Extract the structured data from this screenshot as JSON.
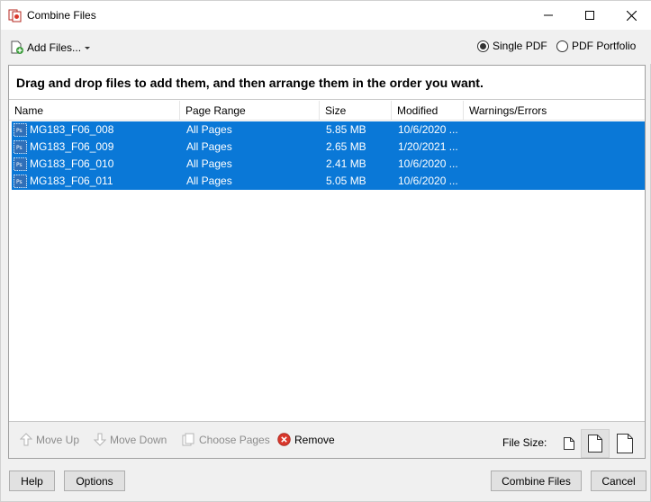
{
  "window": {
    "title": "Combine Files",
    "controls": {
      "minimize": "minimize",
      "maximize": "maximize",
      "close": "close"
    }
  },
  "toolbar": {
    "add_files_label": "Add Files...",
    "output_options": [
      {
        "label": "Single PDF",
        "checked": true
      },
      {
        "label": "PDF Portfolio",
        "checked": false
      }
    ]
  },
  "panel": {
    "instructions": "Drag and drop files to add them, and then arrange them in the order you want.",
    "columns": [
      "Name",
      "Page Range",
      "Size",
      "Modified",
      "Warnings/Errors"
    ],
    "files": [
      {
        "name": "MG183_F06_008",
        "page_range": "All Pages",
        "size": "5.85 MB",
        "modified": "10/6/2020 ...",
        "warnings": "",
        "selected": true
      },
      {
        "name": "MG183_F06_009",
        "page_range": "All Pages",
        "size": "2.65 MB",
        "modified": "1/20/2021 ...",
        "warnings": "",
        "selected": true
      },
      {
        "name": "MG183_F06_010",
        "page_range": "All Pages",
        "size": "2.41 MB",
        "modified": "10/6/2020 ...",
        "warnings": "",
        "selected": true
      },
      {
        "name": "MG183_F06_011",
        "page_range": "All Pages",
        "size": "5.05 MB",
        "modified": "10/6/2020 ...",
        "warnings": "",
        "selected": true
      }
    ]
  },
  "actions": {
    "move_up": "Move Up",
    "move_down": "Move Down",
    "choose_pages": "Choose Pages",
    "remove": "Remove",
    "file_size_label": "File Size:"
  },
  "footer": {
    "help": "Help",
    "options": "Options",
    "combine": "Combine Files",
    "cancel": "Cancel"
  },
  "colors": {
    "selection": "#0a78d7",
    "remove_icon": "#d9372b",
    "disabled_text": "#8c8c8c"
  }
}
